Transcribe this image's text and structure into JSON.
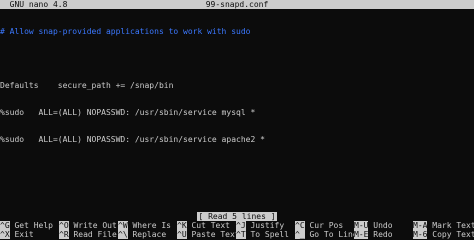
{
  "titlebar": {
    "app": "  GNU nano 4.8",
    "filename": "99-snapd.conf"
  },
  "editor": {
    "lines": [
      "# Allow snap-provided applications to work with sudo",
      "",
      "Defaults    secure_path += /snap/bin",
      "%sudo   ALL=(ALL) NOPASSWD: /usr/sbin/service mysql *",
      "%sudo   ALL=(ALL) NOPASSWD: /usr/sbin/service apache2 *"
    ]
  },
  "status": "[ Read 5 lines ]",
  "shortcuts": [
    {
      "key": "^G",
      "label": "Get Help"
    },
    {
      "key": "^O",
      "label": "Write Out"
    },
    {
      "key": "^W",
      "label": "Where Is"
    },
    {
      "key": "^K",
      "label": "Cut Text"
    },
    {
      "key": "^J",
      "label": "Justify"
    },
    {
      "key": "^C",
      "label": "Cur Pos"
    },
    {
      "key": "M-U",
      "label": "Undo"
    },
    {
      "key": "M-A",
      "label": "Mark Text"
    },
    {
      "key": "^X",
      "label": "Exit"
    },
    {
      "key": "^R",
      "label": "Read File"
    },
    {
      "key": "^\\",
      "label": "Replace"
    },
    {
      "key": "^U",
      "label": "Paste Text"
    },
    {
      "key": "^T",
      "label": "To Spell"
    },
    {
      "key": "^_",
      "label": "Go To Line"
    },
    {
      "key": "M-E",
      "label": "Redo"
    },
    {
      "key": "M-6",
      "label": "Copy Text"
    }
  ]
}
